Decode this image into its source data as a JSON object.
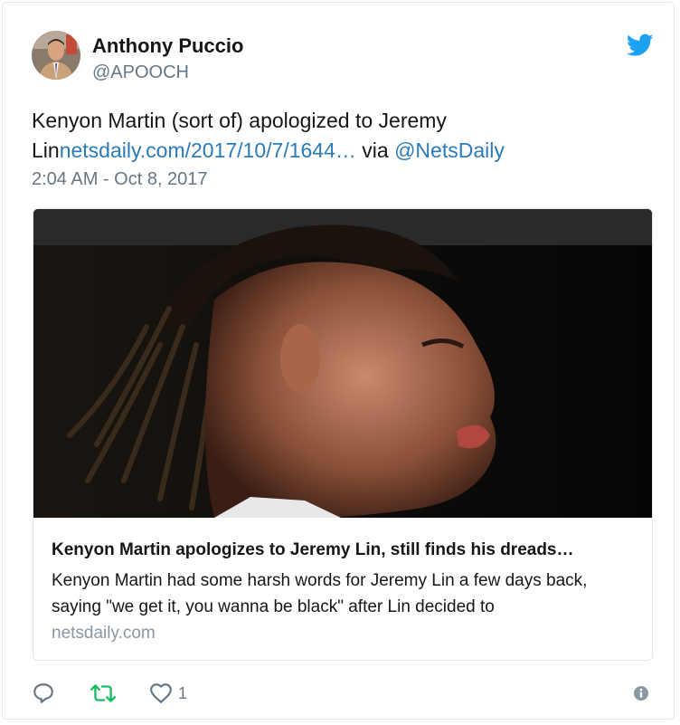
{
  "author": {
    "name": "Anthony Puccio",
    "handle": "@APOOCH"
  },
  "tweet": {
    "text_plain": "Kenyon Martin (sort of) apologized to Jeremy Lin",
    "link_text": "netsdaily.com/2017/10/7/1644…",
    "via_text": " via ",
    "mention": "@NetsDaily",
    "timestamp": "2:04 AM - Oct 8, 2017"
  },
  "card": {
    "title": "Kenyon Martin apologizes to Jeremy Lin, still finds his dreads…",
    "description": "Kenyon Martin had some harsh words for Jeremy Lin a few days back, saying \"we get it, you wanna be black\" after Lin decided to",
    "domain": "netsdaily.com"
  },
  "actions": {
    "like_count": "1"
  },
  "icons": {
    "brand": "twitter-bird-icon",
    "reply": "reply-icon",
    "retweet": "retweet-icon",
    "like": "heart-icon",
    "info": "info-icon"
  },
  "colors": {
    "link": "#2b7bb9",
    "twitter_blue": "#1da1f2",
    "retweet_green": "#17bf63",
    "secondary_text": "#657786"
  }
}
